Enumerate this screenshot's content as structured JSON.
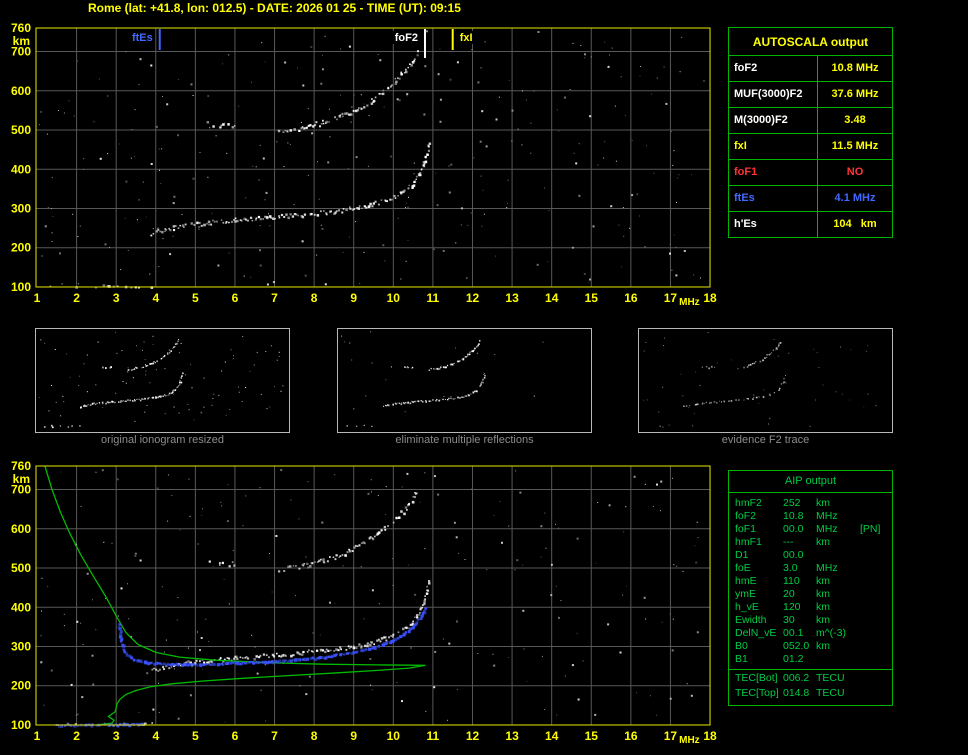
{
  "header": {
    "title": "Rome (lat: +41.8, lon: 012.5) - DATE: 2026 01 25 - TIME (UT): 09:15"
  },
  "colors": {
    "background": "#000000",
    "accent_yellow": "#ffff00",
    "plot_border_yellow": "#e8e800",
    "grid_gray": "#585858",
    "table_green": "#00b400",
    "aip_text_green": "#00cc44",
    "marker_blue": "#4169ff",
    "alert_red": "#ff3333",
    "caption_gray": "#8c8c8c",
    "echo_white": "#ffffff",
    "profile_green": "#00bb00",
    "fit_blue": "#3a52ff"
  },
  "autoscala": {
    "title": "AUTOSCALA output",
    "rows": [
      {
        "label": "foF2",
        "value": "10.8 MHz",
        "label_color": "#ffffff",
        "value_color": "#ffff00"
      },
      {
        "label": "MUF(3000)F2",
        "value": "37.6 MHz",
        "label_color": "#ffffff",
        "value_color": "#ffff00"
      },
      {
        "label": "M(3000)F2",
        "value": "3.48",
        "label_color": "#ffffff",
        "value_color": "#ffff00"
      },
      {
        "label": "fxI",
        "value": "11.5 MHz",
        "label_color": "#ffff00",
        "value_color": "#ffff00"
      },
      {
        "label": "foF1",
        "value": "NO",
        "label_color": "#ff3333",
        "value_color": "#ff3333"
      },
      {
        "label": "ftEs",
        "value": "4.1 MHz",
        "label_color": "#4169ff",
        "value_color": "#4169ff"
      },
      {
        "label": "h'Es",
        "value": "104   km",
        "label_color": "#ffffff",
        "value_color": "#ffff00"
      }
    ]
  },
  "aip": {
    "title": "AIP output",
    "rows": [
      {
        "name": "hmF2",
        "value": "252",
        "unit": "km",
        "note": ""
      },
      {
        "name": "foF2",
        "value": "10.8",
        "unit": "MHz",
        "note": ""
      },
      {
        "name": "foF1",
        "value": "00.0",
        "unit": "MHz",
        "note": "[PN]"
      },
      {
        "name": "hmF1",
        "value": "---",
        "unit": "km",
        "note": ""
      },
      {
        "name": "D1",
        "value": "00.0",
        "unit": "",
        "note": ""
      },
      {
        "name": "foE",
        "value": "3.0",
        "unit": "MHz",
        "note": ""
      },
      {
        "name": "hmE",
        "value": "110",
        "unit": "km",
        "note": ""
      },
      {
        "name": "ymE",
        "value": "20",
        "unit": "km",
        "note": ""
      },
      {
        "name": "h_vE",
        "value": "120",
        "unit": "km",
        "note": ""
      },
      {
        "name": "Ewidth",
        "value": "30",
        "unit": "km",
        "note": ""
      },
      {
        "name": "DelN_vE",
        "value": "00.1",
        "unit": "m^(-3)",
        "note": ""
      },
      {
        "name": "B0",
        "value": "052.0",
        "unit": "km",
        "note": ""
      },
      {
        "name": "B1",
        "value": "01.2",
        "unit": "",
        "note": ""
      },
      {
        "name": "TEC[Bot]",
        "value": "006.2",
        "unit": "TECU",
        "note": "",
        "separator_above": true
      },
      {
        "name": "TEC[Top]",
        "value": "014.8",
        "unit": "TECU",
        "note": ""
      }
    ]
  },
  "thumbnails": [
    {
      "caption": "original ionogram resized",
      "render": {
        "seed": 21,
        "trace_density": 0.85,
        "trace_color": "#ffffff",
        "noise": 90,
        "noise_color": "#ffffff"
      }
    },
    {
      "caption": "eliminate multiple reflections",
      "render": {
        "seed": 22,
        "trace_density": 0.8,
        "trace_color": "#ffffff",
        "noise": 18,
        "noise_color": "#ffffff"
      }
    },
    {
      "caption": "evidence F2 trace",
      "render": {
        "seed": 23,
        "trace_density": 0.45,
        "trace_color": "#cfcfcf",
        "noise": 45,
        "noise_color": "#9a9a9a"
      }
    }
  ],
  "chart_data": [
    {
      "type": "scatter",
      "title": "ionogram with autoscaled characteristics",
      "xlabel": "MHz",
      "ylabel": "km",
      "xlim": [
        1,
        18
      ],
      "ylim": [
        100,
        760
      ],
      "xticks": [
        1,
        2,
        3,
        4,
        5,
        6,
        7,
        8,
        9,
        10,
        11,
        12,
        13,
        14,
        15,
        16,
        17,
        18
      ],
      "yticks": [
        100,
        200,
        300,
        400,
        500,
        600,
        700,
        760
      ],
      "grid": true,
      "axis_color": "#ffff00",
      "grid_color": "#585858",
      "border_color": "#e8e800",
      "noise": {
        "seed": 9,
        "count": 300
      },
      "markers": [
        {
          "label": "ftEs",
          "x": 4.1,
          "color": "#4169ff",
          "side": "left",
          "len": 22
        },
        {
          "label": "foF2",
          "x": 10.8,
          "color": "#ffffff",
          "side": "left",
          "len": 30
        },
        {
          "label": "fxI",
          "x": 11.5,
          "color": "#ffff00",
          "side": "right",
          "len": 22
        }
      ],
      "traces": [
        {
          "name": "F2-trace",
          "color": "#ffffff",
          "density": 0.92,
          "jitter": 2.2,
          "points": [
            [
              3.85,
              238
            ],
            [
              4.2,
              248
            ],
            [
              4.7,
              258
            ],
            [
              5.3,
              266
            ],
            [
              6.0,
              272
            ],
            [
              6.8,
              278
            ],
            [
              7.6,
              285
            ],
            [
              8.3,
              292
            ],
            [
              8.9,
              300
            ],
            [
              9.4,
              310
            ],
            [
              9.8,
              322
            ],
            [
              10.15,
              338
            ],
            [
              10.45,
              360
            ],
            [
              10.62,
              385
            ],
            [
              10.74,
              412
            ],
            [
              10.84,
              445
            ],
            [
              10.88,
              470
            ]
          ]
        },
        {
          "name": "F2-second-hop",
          "color": "#ffffff",
          "density": 0.85,
          "jitter": 2.4,
          "points": [
            [
              7.1,
              498
            ],
            [
              7.7,
              508
            ],
            [
              8.2,
              520
            ],
            [
              8.7,
              538
            ],
            [
              9.1,
              556
            ],
            [
              9.45,
              578
            ],
            [
              9.75,
              602
            ],
            [
              10.05,
              628
            ],
            [
              10.3,
              655
            ],
            [
              10.5,
              682
            ],
            [
              10.6,
              702
            ]
          ]
        },
        {
          "name": "second-hop-left-segment",
          "color": "#ffffff",
          "density": 0.5,
          "jitter": 2.4,
          "points": [
            [
              5.15,
              520
            ],
            [
              5.6,
              514
            ],
            [
              5.95,
              512
            ]
          ]
        },
        {
          "name": "Es-trace",
          "color": "#ffffff",
          "density": 0.22,
          "jitter": 1.6,
          "points": [
            [
              1.2,
              102
            ],
            [
              2.2,
              103
            ],
            [
              3.3,
              104
            ],
            [
              4.05,
              104
            ]
          ]
        }
      ]
    },
    {
      "type": "scatter",
      "title": "ionogram with restored trace and electron density profile",
      "xlabel": "MHz",
      "ylabel": "km",
      "xlim": [
        1,
        18
      ],
      "ylim": [
        100,
        760
      ],
      "xticks": [
        1,
        2,
        3,
        4,
        5,
        6,
        7,
        8,
        9,
        10,
        11,
        12,
        13,
        14,
        15,
        16,
        17,
        18
      ],
      "yticks": [
        100,
        200,
        300,
        400,
        500,
        600,
        700,
        760
      ],
      "grid": true,
      "axis_color": "#ffff00",
      "grid_color": "#585858",
      "border_color": "#e8e800",
      "noise": {
        "seed": 5,
        "count": 230
      },
      "markers": [],
      "traces": [
        {
          "name": "F2-trace",
          "color": "#ffffff",
          "density": 0.9,
          "jitter": 2.2,
          "points": [
            [
              3.85,
              238
            ],
            [
              4.2,
              248
            ],
            [
              4.7,
              258
            ],
            [
              5.3,
              266
            ],
            [
              6.0,
              272
            ],
            [
              6.8,
              278
            ],
            [
              7.6,
              285
            ],
            [
              8.3,
              292
            ],
            [
              8.9,
              300
            ],
            [
              9.4,
              310
            ],
            [
              9.8,
              322
            ],
            [
              10.15,
              338
            ],
            [
              10.45,
              360
            ],
            [
              10.62,
              385
            ],
            [
              10.74,
              412
            ],
            [
              10.84,
              445
            ],
            [
              10.88,
              470
            ]
          ]
        },
        {
          "name": "F2-second-hop",
          "color": "#ffffff",
          "density": 0.8,
          "jitter": 2.4,
          "points": [
            [
              7.1,
              498
            ],
            [
              7.7,
              508
            ],
            [
              8.2,
              520
            ],
            [
              8.7,
              538
            ],
            [
              9.1,
              556
            ],
            [
              9.45,
              578
            ],
            [
              9.75,
              602
            ],
            [
              10.05,
              628
            ],
            [
              10.3,
              655
            ],
            [
              10.5,
              682
            ],
            [
              10.6,
              702
            ]
          ]
        },
        {
          "name": "second-hop-left-segment",
          "color": "#ffffff",
          "density": 0.45,
          "jitter": 2.4,
          "points": [
            [
              5.15,
              520
            ],
            [
              5.6,
              514
            ],
            [
              5.95,
              512
            ]
          ]
        },
        {
          "name": "Es-trace",
          "color": "#ffffff",
          "density": 0.3,
          "jitter": 1.6,
          "points": [
            [
              1.2,
              102
            ],
            [
              2.2,
              103
            ],
            [
              3.3,
              104
            ],
            [
              4.05,
              104
            ]
          ]
        }
      ],
      "profile": {
        "name": "electron-density-profile",
        "color": "#00bb00",
        "points": [
          [
            1.2,
            760
          ],
          [
            1.38,
            700
          ],
          [
            1.58,
            645
          ],
          [
            1.82,
            590
          ],
          [
            2.1,
            535
          ],
          [
            2.42,
            480
          ],
          [
            2.75,
            425
          ],
          [
            3.0,
            378
          ],
          [
            3.25,
            335
          ],
          [
            3.55,
            305
          ],
          [
            4.0,
            285
          ],
          [
            4.6,
            273
          ],
          [
            5.5,
            265
          ],
          [
            6.8,
            259
          ],
          [
            8.2,
            255
          ],
          [
            9.6,
            253
          ],
          [
            10.8,
            252
          ],
          [
            10.4,
            245
          ],
          [
            9.6,
            239
          ],
          [
            8.6,
            233
          ],
          [
            7.4,
            226
          ],
          [
            6.2,
            219
          ],
          [
            5.2,
            212
          ],
          [
            4.4,
            205
          ],
          [
            3.85,
            197
          ],
          [
            3.5,
            188
          ],
          [
            3.25,
            178
          ],
          [
            3.1,
            166
          ],
          [
            3.02,
            154
          ],
          [
            3.0,
            143
          ],
          [
            2.97,
            133
          ],
          [
            2.8,
            122
          ],
          [
            2.95,
            112
          ],
          [
            2.9,
            105
          ],
          [
            2.5,
            100
          ]
        ]
      },
      "fits": [
        {
          "name": "scaled-F2-trace",
          "color": "#3a52ff",
          "size": 2.6,
          "density": 0.95,
          "jitter": 0.8,
          "points": [
            [
              3.05,
              358
            ],
            [
              3.1,
              318
            ],
            [
              3.2,
              288
            ],
            [
              3.4,
              270
            ],
            [
              3.8,
              261
            ],
            [
              4.4,
              257
            ],
            [
              5.2,
              257
            ],
            [
              6.0,
              260
            ],
            [
              6.9,
              264
            ],
            [
              7.7,
              270
            ],
            [
              8.4,
              278
            ],
            [
              9.0,
              288
            ],
            [
              9.5,
              300
            ],
            [
              9.9,
              315
            ],
            [
              10.25,
              334
            ],
            [
              10.5,
              356
            ],
            [
              10.68,
              380
            ],
            [
              10.8,
              402
            ]
          ]
        },
        {
          "name": "scaled-Es-trace",
          "color": "#3a52ff",
          "size": 2.4,
          "density": 0.9,
          "jitter": 0.7,
          "points": [
            [
              1.45,
              101
            ],
            [
              2.2,
              102
            ],
            [
              3.0,
              103
            ],
            [
              3.6,
              104
            ]
          ]
        }
      ]
    }
  ]
}
